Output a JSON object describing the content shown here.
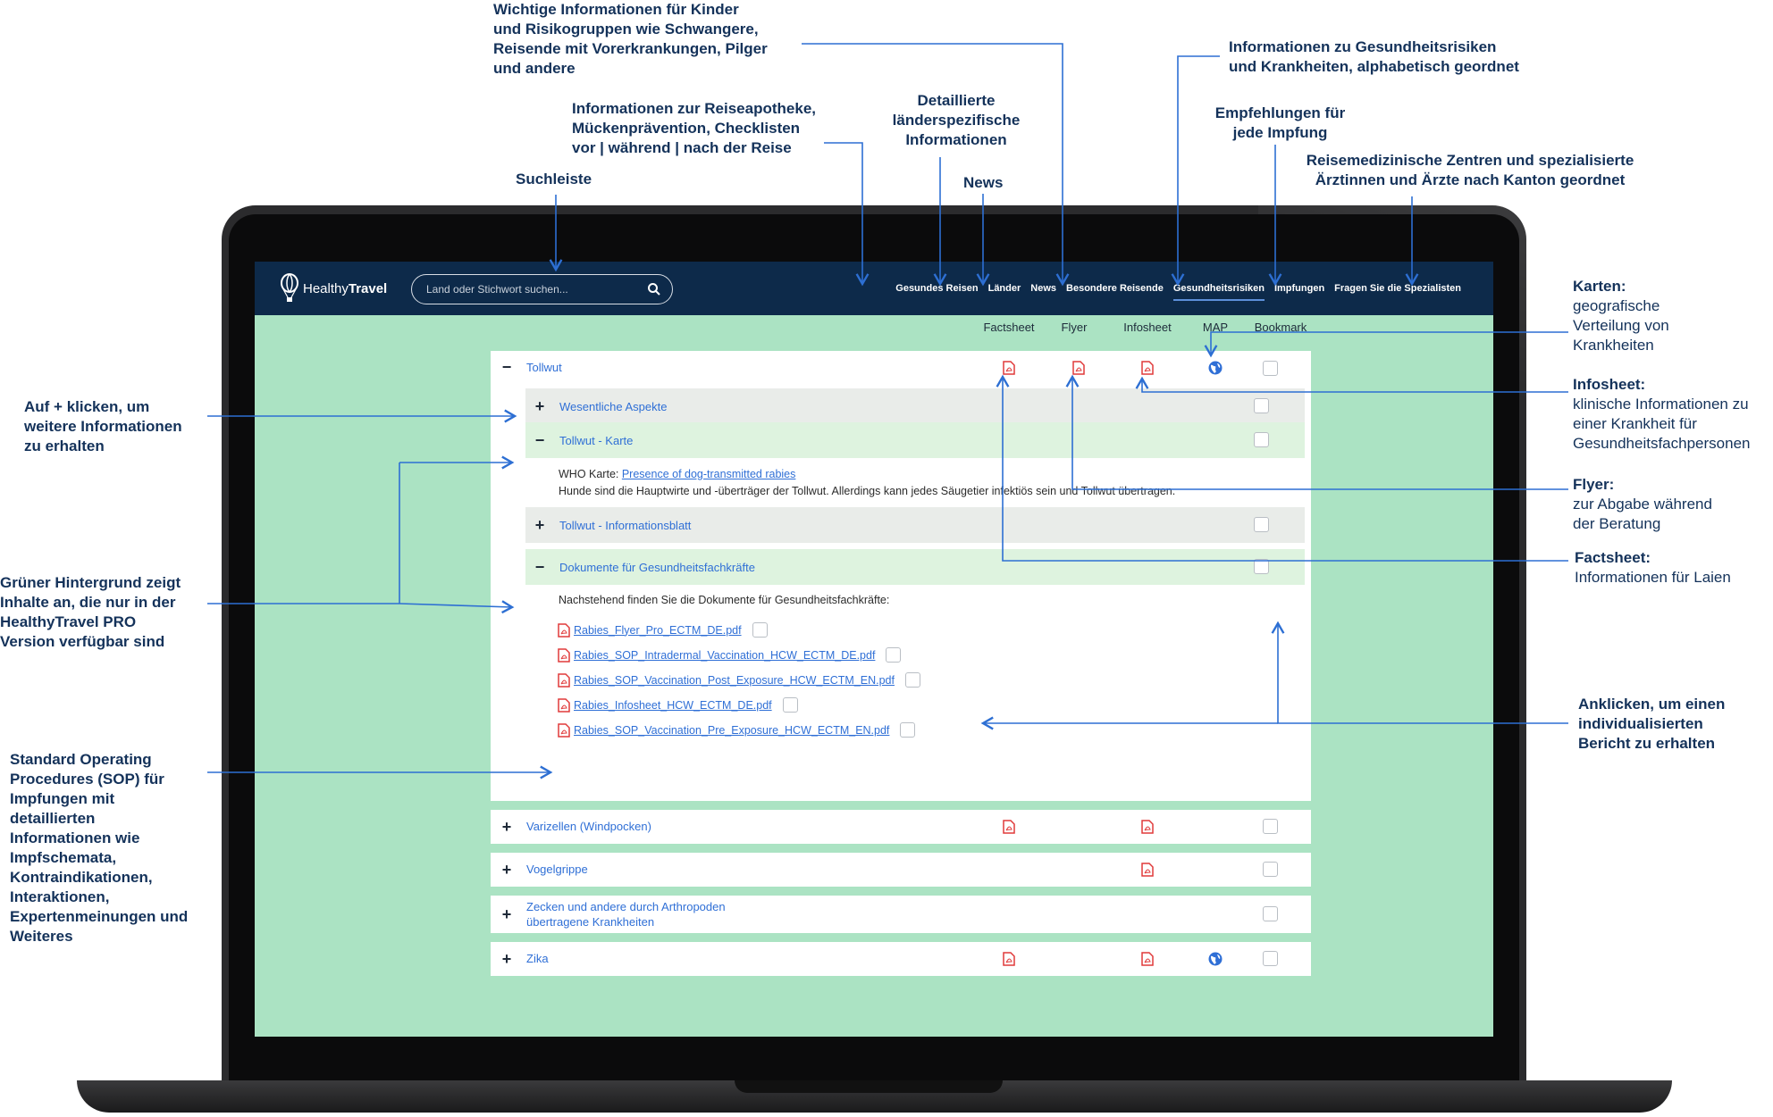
{
  "app": {
    "logo_text_1": "Healthy",
    "logo_text_2": "Travel",
    "search_placeholder": "Land oder Stichwort suchen...",
    "nav": [
      "Gesundes Reisen",
      "Länder",
      "News",
      "Besondere Reisende",
      "Gesundheitsrisiken",
      "Impfungen",
      "Fragen Sie die Spezialisten"
    ],
    "active_nav": "Gesundheitsrisiken",
    "columns": [
      "Factsheet",
      "Flyer",
      "Infosheet",
      "MAP",
      "Bookmark"
    ],
    "tollwut": {
      "title": "Tollwut",
      "sub_1": "Wesentliche Aspekte",
      "sub_2": "Tollwut - Karte",
      "who_label": "WHO Karte: ",
      "who_link": "Presence of dog-transmitted rabies",
      "who_text": "Hunde sind die Hauptwirte und -überträger der Tollwut. Allerdings kann jedes Säugetier infektiös sein und Tollwut übertragen.",
      "sub_3": "Tollwut - Informationsblatt",
      "sub_4": "Dokumente für Gesundheitsfachkräfte",
      "docs_intro": "Nachstehend finden Sie die Dokumente für Gesundheitsfachkräfte:",
      "docs": [
        "Rabies_Flyer_Pro_ECTM_DE.pdf",
        "Rabies_SOP_Intradermal_Vaccination_HCW_ECTM_DE.pdf",
        "Rabies_SOP_Vaccination_Post_Exposure_HCW_ECTM_EN.pdf",
        "Rabies_Infosheet_HCW_ECTM_DE.pdf",
        "Rabies_SOP_Vaccination_Pre_Exposure_HCW_ECTM_EN.pdf"
      ]
    },
    "diseases": [
      {
        "title": "Varizellen (Windpocken)"
      },
      {
        "title": "Vogelgrippe"
      },
      {
        "title": "Zecken und andere durch Arthropoden übertragene Krankheiten",
        "title_1": "Zecken und andere durch Arthropoden",
        "title_2": "übertragene Krankheiten"
      },
      {
        "title": "Zika"
      }
    ]
  },
  "annotations": {
    "top_1": [
      "Wichtige Informationen für Kinder",
      "und Risikogruppen wie Schwangere,",
      "Reisende mit Vorerkrankungen, Pilger",
      "und andere"
    ],
    "top_2": [
      "Informationen zur Reiseapotheke,",
      "Mückenprävention, Checklisten",
      "vor | während | nach der Reise"
    ],
    "top_3": [
      "Detaillierte",
      "länderspezifische",
      "Informationen"
    ],
    "top_news": "News",
    "top_search": "Suchleiste",
    "top_4": [
      "Informationen zu Gesundheitsrisiken",
      "und Krankheiten, alphabetisch geordnet"
    ],
    "top_5": [
      "Empfehlungen für",
      "jede Impfung"
    ],
    "top_6": [
      "Reisemedizinische Zentren und spezialisierte",
      "Ärztinnen und Ärzte nach Kanton geordnet"
    ],
    "left_1": [
      "Auf + klicken, um",
      "weitere Informationen",
      "zu erhalten"
    ],
    "left_2": [
      "Grüner Hintergrund zeigt",
      "Inhalte an, die nur in der",
      "HealthyTravel PRO",
      "Version verfügbar sind"
    ],
    "left_3": [
      "Standard Operating",
      "Procedures (SOP) für",
      "Impfungen mit",
      "detaillierten",
      "Informationen wie",
      "Impfschemata,",
      "Kontraindikationen,",
      "Interaktionen,",
      "Expertenmeinungen und",
      "Weiteres"
    ],
    "right_karten_title": "Karten:",
    "right_karten": [
      "geografische",
      "Verteilung von",
      "Krankheiten"
    ],
    "right_infosheet_title": "Infosheet:",
    "right_infosheet": [
      "klinische Informationen zu",
      "einer Krankheit für",
      "Gesundheitsfachpersonen"
    ],
    "right_flyer_title": "Flyer:",
    "right_flyer": [
      "zur Abgabe während",
      "der Beratung"
    ],
    "right_factsheet_title": "Factsheet:",
    "right_factsheet": [
      "Informationen für Laien"
    ],
    "right_bericht": [
      "Anklicken, um einen",
      "individualisierten",
      "Bericht zu erhalten"
    ]
  },
  "colors": {
    "navbar": "#0d2a4a",
    "screen_bg": "#abe3c3",
    "link": "#2f6fd6",
    "annotation": "#14325a",
    "pdf_red": "#e03a3a",
    "arrow": "#2d6fd3"
  },
  "icons": [
    "healthytravel-balloon-icon",
    "search-icon",
    "pdf-icon",
    "globe-icon",
    "plus-icon",
    "minus-icon"
  ]
}
